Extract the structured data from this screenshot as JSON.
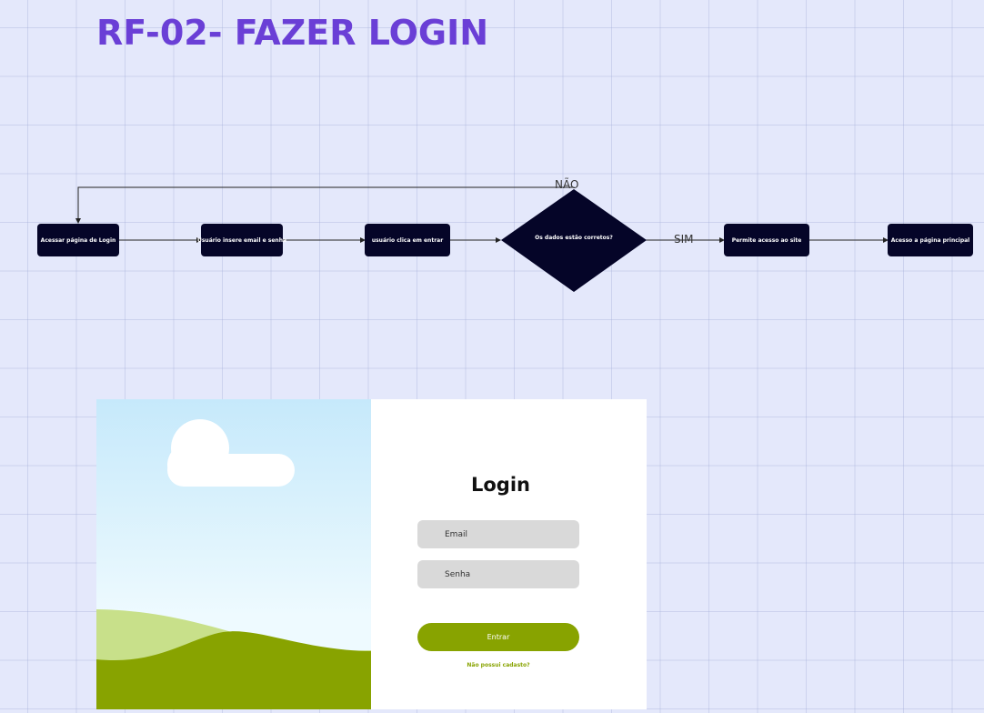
{
  "header": {
    "title": "RF-02- FAZER LOGIN"
  },
  "flowchart": {
    "nodes": [
      {
        "id": "n1",
        "label": "Acessar página de Login"
      },
      {
        "id": "n2",
        "label": "Usuário insere email e senha"
      },
      {
        "id": "n3",
        "label": "usuário clica em entrar"
      },
      {
        "id": "n4",
        "label": "Os dados estão corretos?"
      },
      {
        "id": "n5",
        "label": "Permite acesso ao site"
      },
      {
        "id": "n6",
        "label": "Acesso a página principal"
      }
    ],
    "edges": [
      {
        "from": "n1",
        "to": "n2",
        "label": ""
      },
      {
        "from": "n2",
        "to": "n3",
        "label": ""
      },
      {
        "from": "n3",
        "to": "n4",
        "label": ""
      },
      {
        "from": "n4",
        "to": "n5",
        "label": "SIM"
      },
      {
        "from": "n5",
        "to": "n6",
        "label": ""
      },
      {
        "from": "n4",
        "to": "n1",
        "label": "NÃO"
      }
    ]
  },
  "login": {
    "title": "Login",
    "email_placeholder": "Email",
    "password_placeholder": "Senha",
    "submit_label": "Entrar",
    "signup_link": "Não possui cadasto?"
  },
  "colors": {
    "title": "#6a3fd6",
    "node_fill": "#050528",
    "accent_green": "#88a300",
    "sky": "#c6e9fb",
    "hill_light": "#c8e08a",
    "field_bg": "#d9d9d9"
  }
}
